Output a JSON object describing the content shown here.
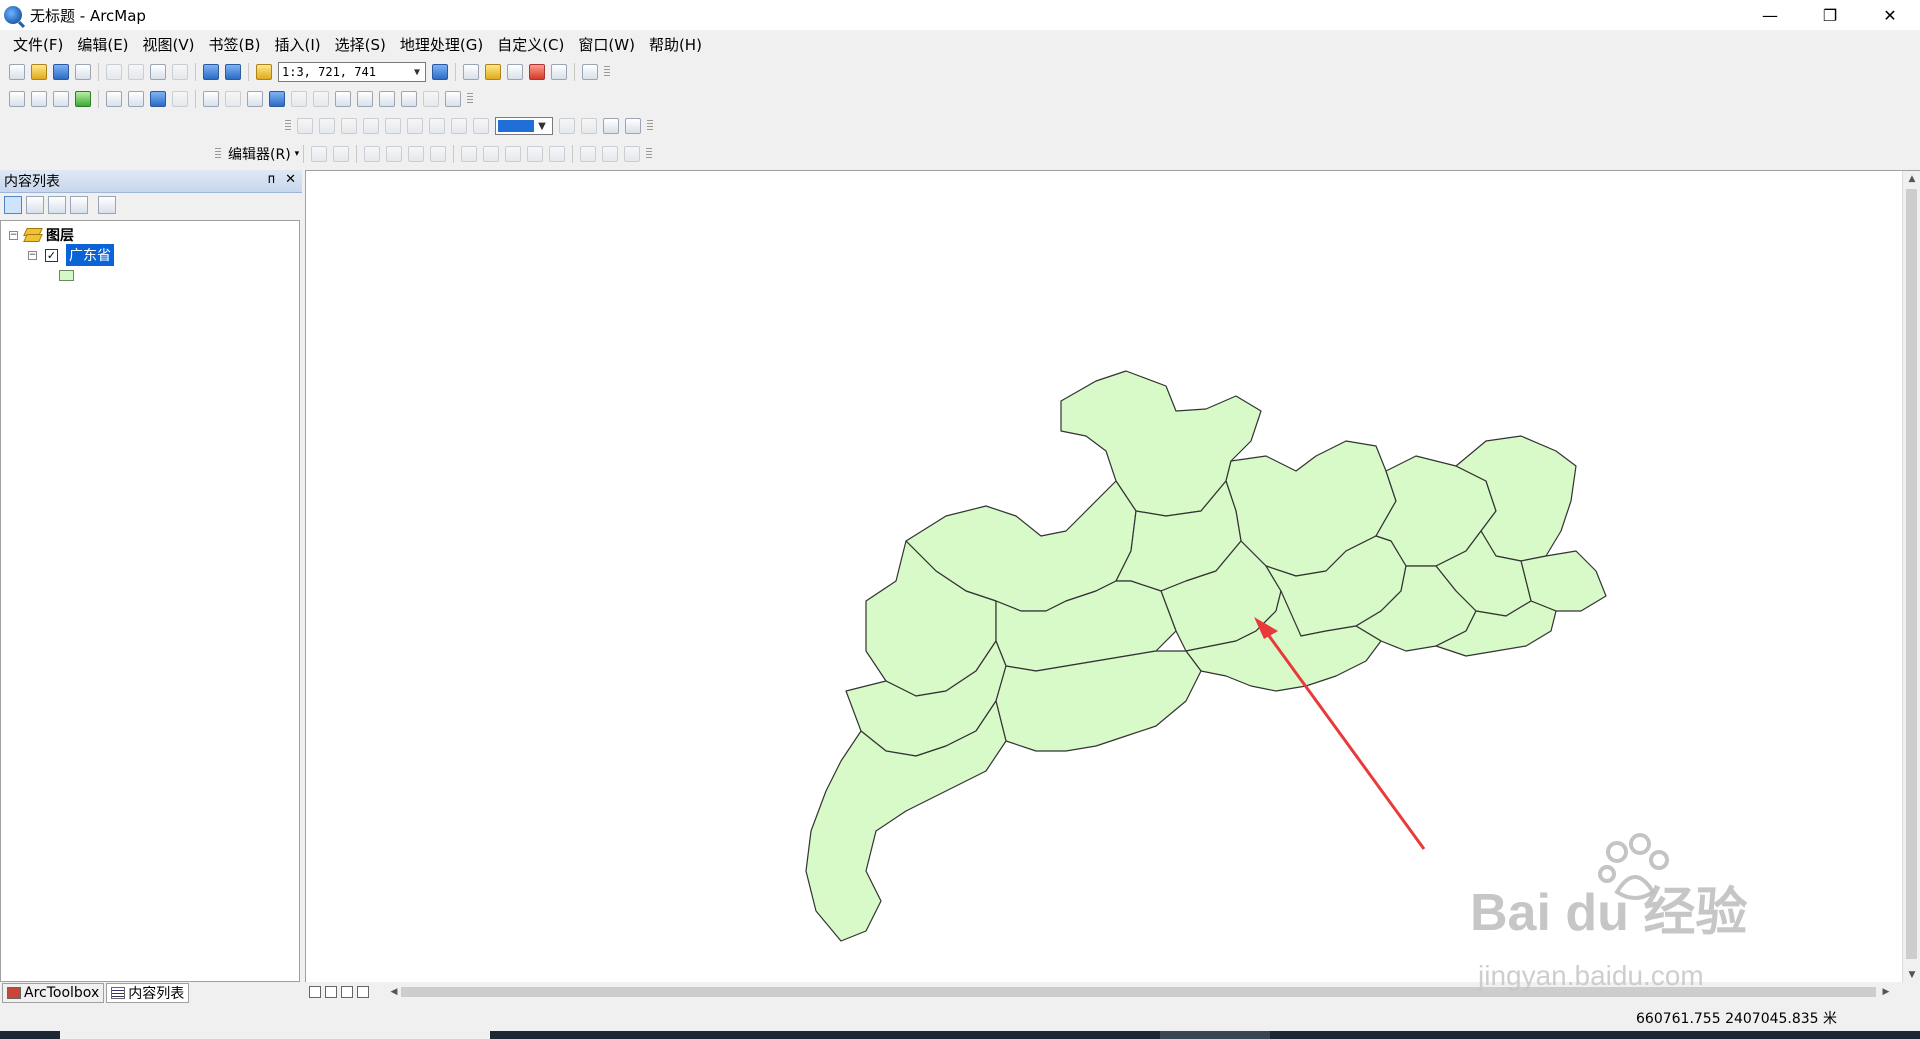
{
  "window": {
    "title": "无标题 - ArcMap",
    "controls": [
      "—",
      "❐",
      "✕"
    ]
  },
  "menu": {
    "items": [
      "文件(F)",
      "编辑(E)",
      "视图(V)",
      "书签(B)",
      "插入(I)",
      "选择(S)",
      "地理处理(G)",
      "自定义(C)",
      "窗口(W)",
      "帮助(H)"
    ]
  },
  "toolbar": {
    "scale_value": "1:3, 721, 741",
    "editor_label": "编辑器(R)"
  },
  "toc": {
    "title": "内容列表",
    "pin": "ᴨ",
    "close": "✕",
    "group_label": "图层",
    "layer_label": "广东省",
    "expander_symbol": "−",
    "check_symbol": "✓",
    "tabs": [
      "ArcToolbox",
      "内容列表"
    ]
  },
  "map": {
    "fill_color": "#d8f9c8",
    "outline_color": "#333333",
    "arrow_color": "#e83a3a"
  },
  "status": {
    "coordinates": "660761.755  2407045.835 米"
  },
  "watermark": {
    "brand": "Bai  du 经验",
    "url": "jingyan.baidu.com"
  }
}
